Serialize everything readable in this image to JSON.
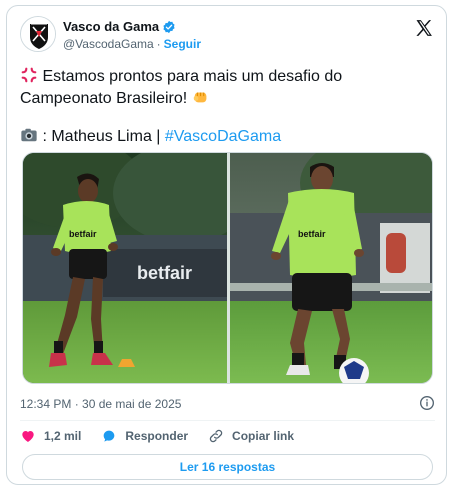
{
  "colors": {
    "link": "#1d9bf0",
    "text": "#0f1419",
    "muted": "#536471",
    "like_heart": "#f91880",
    "border": "#cfd9de"
  },
  "tweet": {
    "author": {
      "name": "Vasco da Gama",
      "handle": "@VascodaGama",
      "separator": "·",
      "follow_label": "Seguir",
      "verified_icon": "verified-badge-icon",
      "avatar_icon": "vasco-crest-icon"
    },
    "platform_icon": "x-logo-icon",
    "text": {
      "line1": "Estamos prontos para mais um desafio do",
      "line2": "Campeonato Brasileiro!",
      "credit_prefix": ": Matheus Lima | ",
      "hashtag": "#VascoDaGama"
    },
    "emojis": [
      "anger-symbol-emoji",
      "fist-bump-emoji",
      "camera-emoji"
    ],
    "photos": [
      {
        "subject": "player running on training pitch",
        "shirt_sponsor": "betfair",
        "banner_text": "betfair"
      },
      {
        "subject": "player dribbling ball",
        "shirt_sponsor": "betfair"
      }
    ],
    "timestamp": "12:34 PM · 30 de mai de 2025",
    "actions": {
      "likes_count": "1,2 mil",
      "reply_label": "Responder",
      "copy_label": "Copiar link"
    },
    "replies_button": "Ler 16 respostas"
  }
}
